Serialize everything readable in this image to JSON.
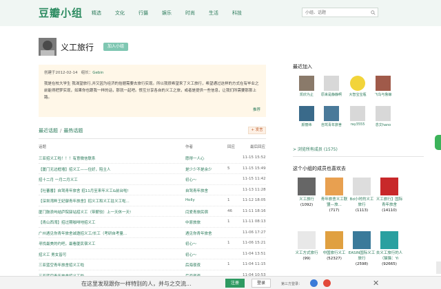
{
  "header": {
    "logo": "豆瓣小组",
    "nav": [
      "精选",
      "文化",
      "行摄",
      "娱乐",
      "时尚",
      "生活",
      "科技"
    ],
    "search_placeholder": "小组、话题"
  },
  "group": {
    "title": "义工旅行",
    "join_label": "加入小组",
    "created": "创建于2012-02-14",
    "owner_label": "组长：",
    "owner": "Gebin",
    "description": "我是在校大学生 我渴望旅行,并又因为经济的拮据需要去旅行实现。所以我很希望来了义工旅行，希望通过这样的方式在有毕业之前能得把梦实现，如果你也跟我一样的话，那就一起吧。恨互分享各自的义工之旅，或者是提供一些信息，让我们所需要那那上路。",
    "more_label": "推荐"
  },
  "topics": {
    "tab_latest": "最近话题",
    "tab_sep": "/",
    "tab_hot": "最热话题",
    "post_button": "+ 发言",
    "headers": {
      "title": "话题",
      "author": "作者",
      "replies": "回应",
      "last_reply": "最后回应"
    },
    "rows": [
      {
        "title": "三亚招义工啦！！！有意微信联系",
        "author": "愿得一人心",
        "replies": "",
        "date": "11-15 15:52"
      },
      {
        "title": "【厦门无边框墙】招义工——住好，陪主人",
        "author": "是少少不是余少",
        "replies": "5",
        "date": "11-15 15:49"
      },
      {
        "title": "招十二月 一月二月义工",
        "author": "初心～",
        "replies": "",
        "date": "11-15 11:42"
      },
      {
        "title": "【吐蕃番】自驾青年旅舍 招11月至来年义工&前台啦!",
        "author": "自驾青年旅舍",
        "replies": "",
        "date": "11-13 11:28"
      },
      {
        "title": "【深圳湾畔王妃御青年旅舍】招义工和义工驻义工啦...",
        "author": "Holly",
        "replies": "1",
        "date": "11-12 18:05"
      },
      {
        "title": "厦门鼓浪屿结庐院驿站招义工（带薪较）上一天休一天!",
        "author": "闫爱青旅民宿",
        "replies": "46",
        "date": "11-11 18:16"
      },
      {
        "title": "【青山西湾】招过期咖啡地招义工",
        "author": "中原旅旅",
        "replies": "1",
        "date": "11-11 08:13"
      },
      {
        "title": "广州遇见你青年旅舍诚邀招义工/长工（考研自考量...",
        "author": "遇见你青年旅舍",
        "replies": "",
        "date": "11-06 17:27"
      },
      {
        "title": "寻找最美的约吧，最看厦民宿义工",
        "author": "初心～",
        "replies": "1",
        "date": "11-06 15:21"
      },
      {
        "title": "招义工 男女皆可",
        "author": "初心～",
        "replies": "",
        "date": "11-04 13:51"
      },
      {
        "title": "三亚蓝空青年旅舍招义工啦",
        "author": "后海夜夜",
        "replies": "1",
        "date": "11-04 11:15"
      },
      {
        "title": "三亚蓝空青年旅舍招义工啦",
        "author": "后海夜夜",
        "replies": "",
        "date": "11-04 10:53"
      }
    ]
  },
  "sidebar": {
    "recent_title": "最近加入",
    "members": [
      {
        "name": "凯欣为止",
        "color": "#8a7a6a"
      },
      {
        "name": "原来是静静啊",
        "color": "#d8d8d8"
      },
      {
        "name": "大智宝宝瓶",
        "color": "#f2d43a"
      },
      {
        "name": "飞鸟与鲁鲸",
        "color": "#a05a4a"
      },
      {
        "name": "颜丽纬",
        "color": "#3a6a8a"
      },
      {
        "name": "自驾青年旅舍",
        "color": "#4a7a9a"
      },
      {
        "name": "ray3555",
        "color": "#d8d8d8"
      },
      {
        "name": "念文hano",
        "color": "#d8d8d8"
      }
    ],
    "browse_label": "> 浏览所有成员 (1575)",
    "related_title": "这个小组的成员也喜欢去",
    "related": [
      {
        "name": "义工旅行",
        "count": "(1092)",
        "color": "#666666"
      },
      {
        "name": "青年旅舍义工联盟—旅...",
        "count": "(717)",
        "color": "#e8a050"
      },
      {
        "name": "Bd小时的义工旅行",
        "count": "(1113)",
        "color": "#dddddd"
      },
      {
        "name": "义工旅行】国际青年旅舍",
        "count": "(14110)",
        "color": "#c8282a"
      },
      {
        "name": "义工方式旅行",
        "count": "(99)",
        "color": "#e8e8e8"
      },
      {
        "name": "中国旅行义工",
        "count": "(52327)",
        "color": "#e0a040"
      },
      {
        "name": "EASIN国际义工旅行",
        "count": "(2598)",
        "color": "#3a7a9a"
      },
      {
        "name": "去义工旅行的人（猫猫：Yi",
        "count": "(92665)",
        "color": "#2aa0a0"
      }
    ]
  },
  "bottom_bar": {
    "message": "在这里发现跟你一样特别的人，并与之交流...",
    "register": "注册",
    "login": "登录",
    "third_party": "第三方登录："
  }
}
